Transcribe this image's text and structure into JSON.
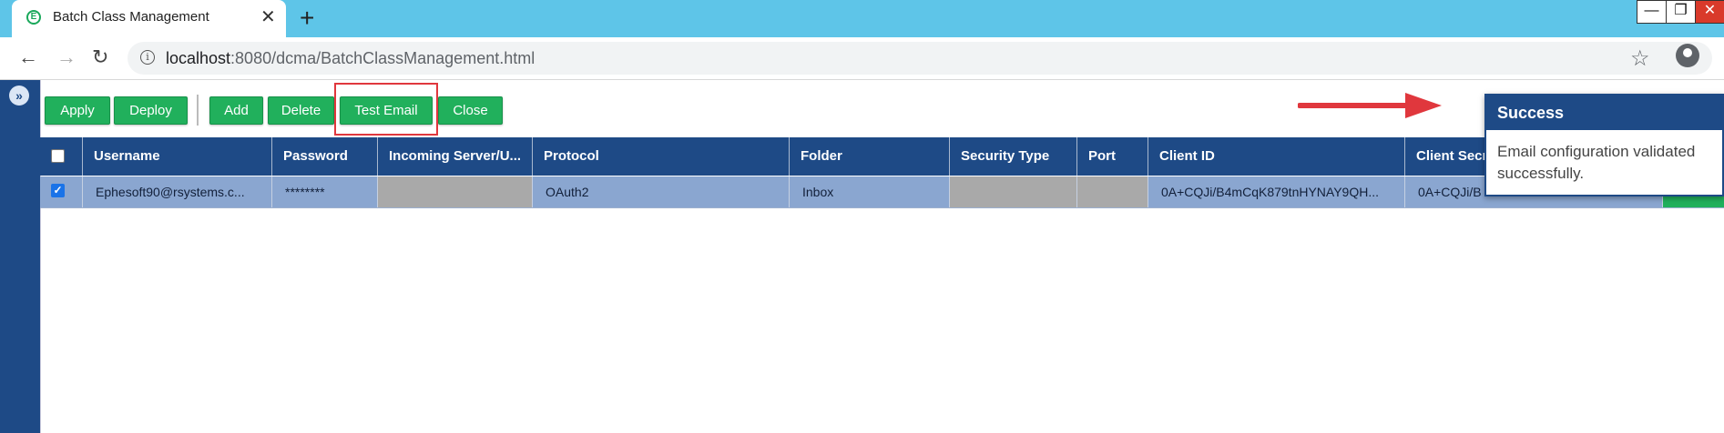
{
  "browser": {
    "tab_title": "Batch Class Management",
    "favicon_letter": "E",
    "tab_close": "✕",
    "new_tab": "+",
    "url_host": "localhost",
    "url_path": ":8080/dcma/BatchClassManagement.html",
    "window_controls": {
      "minimize": "—",
      "restore": "❐",
      "close": "✕"
    },
    "nav": {
      "back": "←",
      "forward": "→",
      "reload": "↻"
    },
    "info": "i",
    "star": "☆"
  },
  "sidebar": {
    "toggle": "»"
  },
  "toolbar": {
    "buttons": [
      "Apply",
      "Deploy",
      "Add",
      "Delete",
      "Test Email",
      "Close"
    ]
  },
  "table": {
    "columns": [
      "Username",
      "Password",
      "Incoming Server/U...",
      "Protocol",
      "Folder",
      "Security Type",
      "Port",
      "Client ID",
      "Client Secr"
    ],
    "rows": [
      {
        "checked": true,
        "cells": [
          "Ephesoft90@rsystems.c...",
          "********",
          "",
          "OAuth2",
          "Inbox",
          "",
          "",
          "0A+CQJi/B4mCqK879tnHYNAY9QH...",
          "0A+CQJi/B"
        ]
      }
    ]
  },
  "toast": {
    "title": "Success",
    "message": "Email configuration validated successfully."
  },
  "colors": {
    "header_blue": "#1e4a86",
    "button_green": "#21b05c",
    "row_selected": "#8aa6d0",
    "highlight_red": "#e0373d",
    "tabstrip": "#5ec5e8"
  }
}
